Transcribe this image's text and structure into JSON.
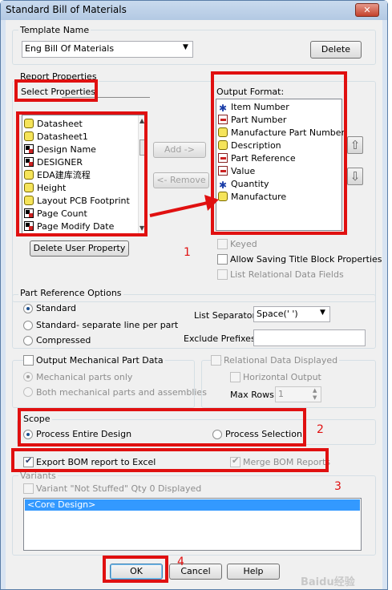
{
  "window": {
    "title": "Standard Bill of Materials",
    "close_glyph": "✕"
  },
  "template": {
    "group": "Template Name",
    "value": "Eng Bill Of Materials",
    "delete_label": "Delete"
  },
  "report": {
    "group": "Report Properties",
    "select_label": "Select Properties:",
    "select_items": [
      {
        "label": "Datasheet",
        "icon": "database-icon"
      },
      {
        "label": "Datasheet1",
        "icon": "database-icon"
      },
      {
        "label": "Design Name",
        "icon": "block-icon"
      },
      {
        "label": "DESIGNER",
        "icon": "block-icon"
      },
      {
        "label": "EDA建库流程",
        "icon": "database-icon"
      },
      {
        "label": "Height",
        "icon": "database-icon"
      },
      {
        "label": "Layout PCB Footprint",
        "icon": "database-icon"
      },
      {
        "label": "Page Count",
        "icon": "block-icon"
      },
      {
        "label": "Page Modify Date",
        "icon": "block-icon"
      }
    ],
    "add_label": "Add ->",
    "remove_label": "<- Remove",
    "output_label": "Output Format:",
    "output_items": [
      {
        "label": "Item Number",
        "icon": "star-icon"
      },
      {
        "label": "Part Number",
        "icon": "pin-icon"
      },
      {
        "label": "Manufacture Part Number",
        "icon": "database-icon"
      },
      {
        "label": "Description",
        "icon": "database-icon"
      },
      {
        "label": "Part Reference",
        "icon": "pin-icon"
      },
      {
        "label": "Value",
        "icon": "pin-icon"
      },
      {
        "label": "Quantity",
        "icon": "star-icon"
      },
      {
        "label": "Manufacture",
        "icon": "database-icon"
      }
    ],
    "delete_user_label": "Delete User Property",
    "keyed_label": "Keyed",
    "allow_label": "Allow Saving Title Block Properties",
    "list_relational_label": "List Relational Data Fields",
    "allow_checked": false
  },
  "partref": {
    "group": "Part Reference Options",
    "standard": "Standard",
    "separate": "Standard- separate line per part",
    "compressed": "Compressed",
    "separator_label": "List Separator:",
    "separator_value": "Space(' ')",
    "exclude_label": "Exclude Prefixes:",
    "exclude_value": ""
  },
  "mech": {
    "label": "Output Mechanical Part Data",
    "only": "Mechanical parts only",
    "both": "Both mechanical parts and assemblies",
    "relational_label": "Relational Data Displayed",
    "horizontal_label": "Horizontal Output",
    "maxrows_label": "Max Rows",
    "maxrows_value": "1"
  },
  "scope": {
    "group": "Scope",
    "entire": "Process Entire Design",
    "selection": "Process Selection"
  },
  "export": {
    "label": "Export BOM report to Excel",
    "merge_label": "Merge BOM Reports"
  },
  "variants": {
    "group": "Variants",
    "not_stuffed": "Variant \"Not Stuffed\" Qty 0 Displayed",
    "selected": "<Core Design>"
  },
  "buttons": {
    "ok": "OK",
    "cancel": "Cancel",
    "help": "Help"
  },
  "annotations": [
    "1",
    "2",
    "3",
    "4"
  ],
  "watermark": "Baidu经验",
  "colors": {
    "highlight_red": "#e01010",
    "selection_blue": "#3399ff",
    "title_bar": "#b9cfe8"
  }
}
